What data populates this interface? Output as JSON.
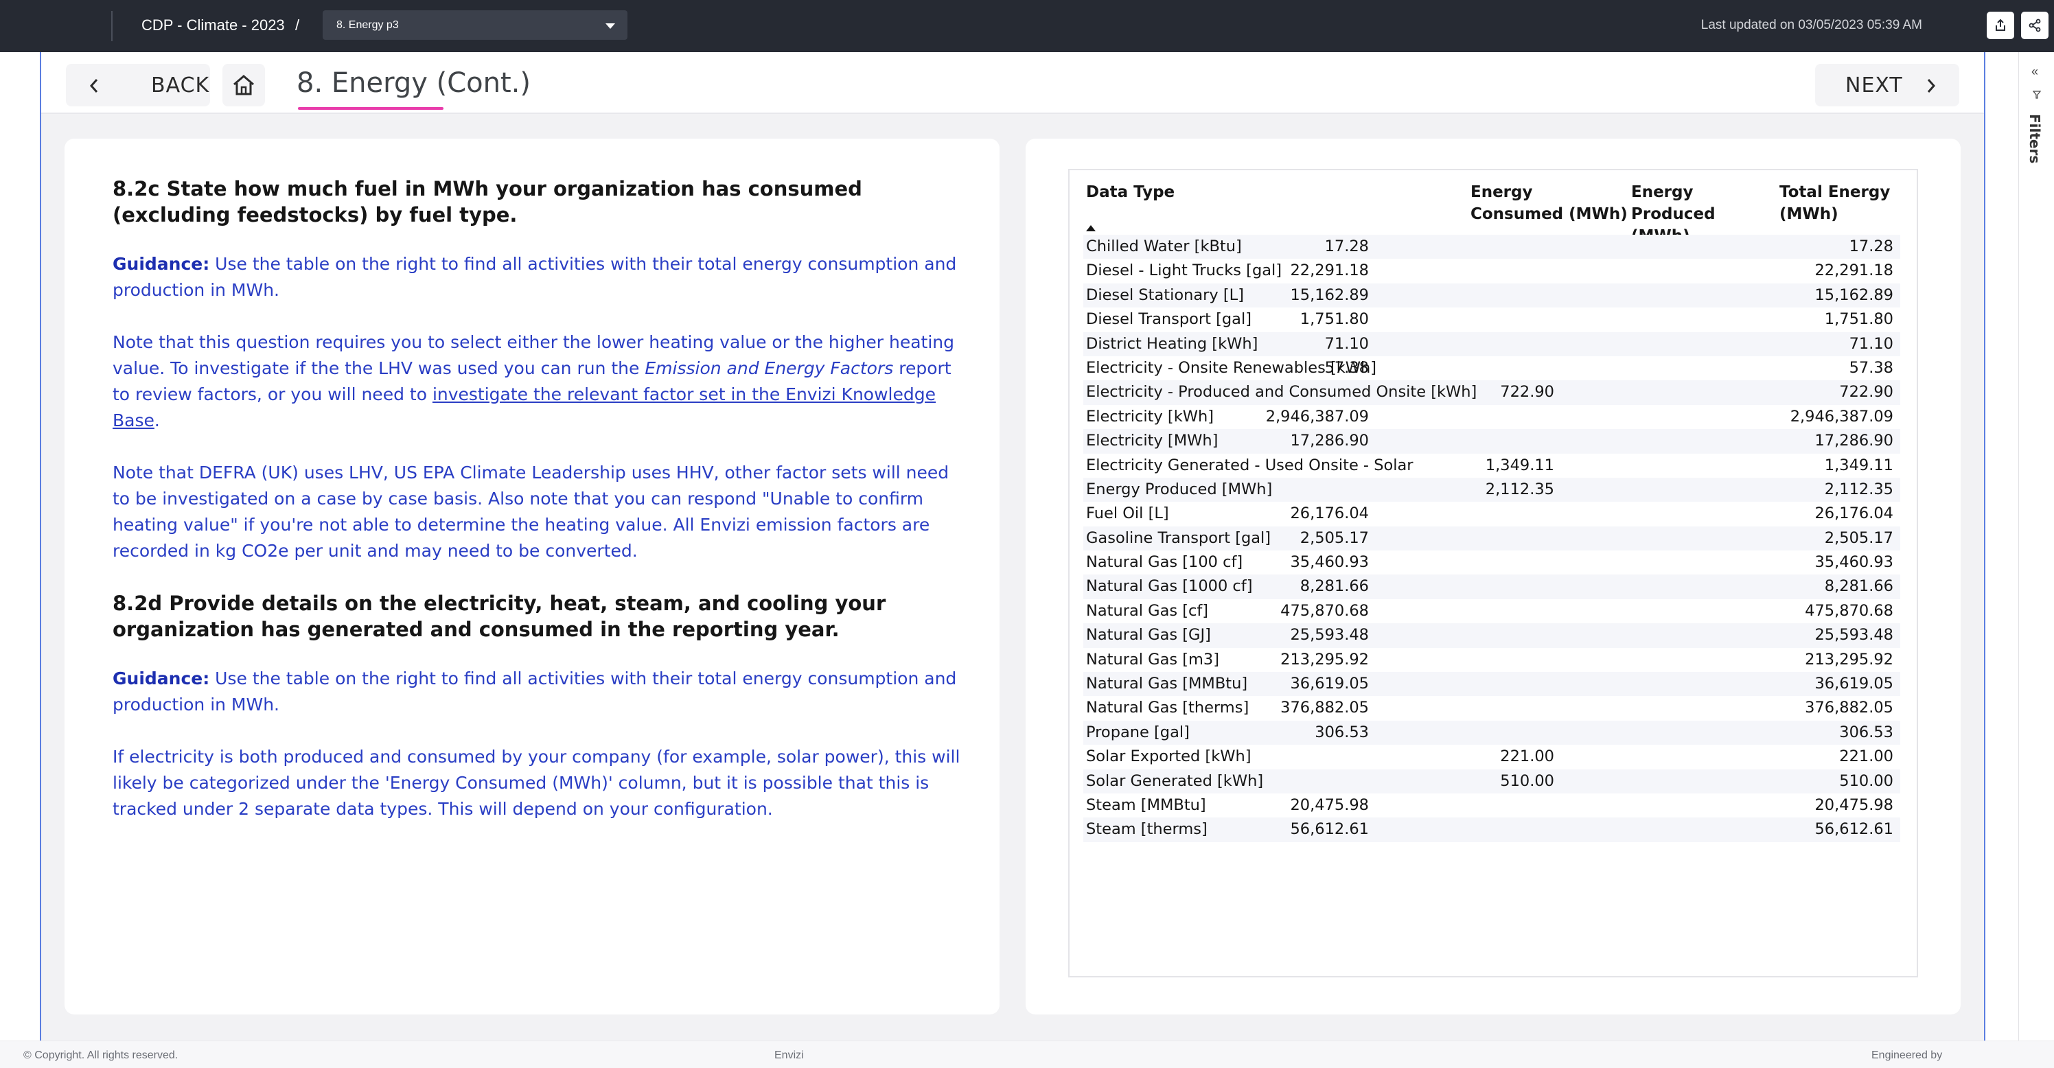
{
  "topbar": {
    "breadcrumb": "CDP - Climate - 2023",
    "separator": "/",
    "page_select_value": "8. Energy p3",
    "last_updated": "Last updated on 03/05/2023 05:39 AM"
  },
  "header": {
    "back_label": "BACK",
    "title": "8. Energy (Cont.)",
    "next_label": "NEXT"
  },
  "guidance": {
    "q1_heading": "8.2c State how much fuel in MWh your organization has consumed (excluding feedstocks) by fuel type.",
    "guidance_label": "Guidance:",
    "q1_guidance_text": " Use the table on the right to find all activities with their total energy consumption and production in MWh.",
    "p2_part1": "Note that this question requires you to select either the lower heating value or the higher heating value. To investigate if the the LHV was used you can run the ",
    "p2_italic": "Emission and Energy Factors",
    "p2_part2": " report to review factors, or you will need to ",
    "p2_link": "investigate the relevant factor set in the Envizi Knowledge Base",
    "p2_end": ".",
    "p3": "Note that DEFRA (UK) uses LHV, US EPA Climate Leadership uses HHV, other factor sets will need to be investigated on a case by case basis. Also note that you can respond \"Unable to confirm heating value\" if you're not able to determine the heating value. All Envizi emission factors are recorded in kg CO2e per unit and may need to be converted.",
    "q2_heading": "8.2d Provide details on the electricity, heat, steam, and cooling your organization has generated and consumed in the reporting year.",
    "q2_guidance_text": " Use the table on the right to find all activities with their total energy consumption and production in MWh.",
    "p5": "If electricity is both produced and consumed by your company (for example, solar power), this will likely be categorized under the 'Energy Consumed (MWh)' column, but it is possible that this is tracked under 2 separate data types. This will depend on your configuration."
  },
  "table": {
    "headers": [
      "Data Type",
      "Energy Consumed (MWh)",
      "Energy Produced (MWh)",
      "Total Energy (MWh)"
    ],
    "rows": [
      [
        "Chilled Water [kBtu]",
        "17.28",
        "",
        "17.28"
      ],
      [
        "Diesel - Light Trucks [gal]",
        "22,291.18",
        "",
        "22,291.18"
      ],
      [
        "Diesel Stationary [L]",
        "15,162.89",
        "",
        "15,162.89"
      ],
      [
        "Diesel Transport [gal]",
        "1,751.80",
        "",
        "1,751.80"
      ],
      [
        "District Heating [kWh]",
        "71.10",
        "",
        "71.10"
      ],
      [
        "Electricity - Onsite Renewables [kWh]",
        "57.38",
        "",
        "57.38"
      ],
      [
        "Electricity - Produced and Consumed Onsite [kWh]",
        "",
        "722.90",
        "722.90"
      ],
      [
        "Electricity [kWh]",
        "2,946,387.09",
        "",
        "2,946,387.09"
      ],
      [
        "Electricity [MWh]",
        "17,286.90",
        "",
        "17,286.90"
      ],
      [
        "Electricity Generated - Used Onsite - Solar",
        "",
        "1,349.11",
        "1,349.11"
      ],
      [
        "Energy Produced [MWh]",
        "",
        "2,112.35",
        "2,112.35"
      ],
      [
        "Fuel Oil [L]",
        "26,176.04",
        "",
        "26,176.04"
      ],
      [
        "Gasoline Transport [gal]",
        "2,505.17",
        "",
        "2,505.17"
      ],
      [
        "Natural Gas [100 cf]",
        "35,460.93",
        "",
        "35,460.93"
      ],
      [
        "Natural Gas [1000 cf]",
        "8,281.66",
        "",
        "8,281.66"
      ],
      [
        "Natural Gas [cf]",
        "475,870.68",
        "",
        "475,870.68"
      ],
      [
        "Natural Gas [GJ]",
        "25,593.48",
        "",
        "25,593.48"
      ],
      [
        "Natural Gas [m3]",
        "213,295.92",
        "",
        "213,295.92"
      ],
      [
        "Natural Gas [MMBtu]",
        "36,619.05",
        "",
        "36,619.05"
      ],
      [
        "Natural Gas [therms]",
        "376,882.05",
        "",
        "376,882.05"
      ],
      [
        "Propane [gal]",
        "306.53",
        "",
        "306.53"
      ],
      [
        "Solar Exported [kWh]",
        "",
        "221.00",
        "221.00"
      ],
      [
        "Solar Generated [kWh]",
        "",
        "510.00",
        "510.00"
      ],
      [
        "Steam [MMBtu]",
        "20,475.98",
        "",
        "20,475.98"
      ],
      [
        "Steam [therms]",
        "56,612.61",
        "",
        "56,612.61"
      ]
    ]
  },
  "filters": {
    "label": "Filters"
  },
  "footer": {
    "copyright": "© Copyright. All rights reserved.",
    "center": "Envizi",
    "right": "Engineered by"
  },
  "colors": {
    "topbar_bg": "#262a33",
    "guidance_text": "#2a3ec4",
    "title_underline": "#e93cab",
    "frame_border": "#5b7ee0"
  }
}
